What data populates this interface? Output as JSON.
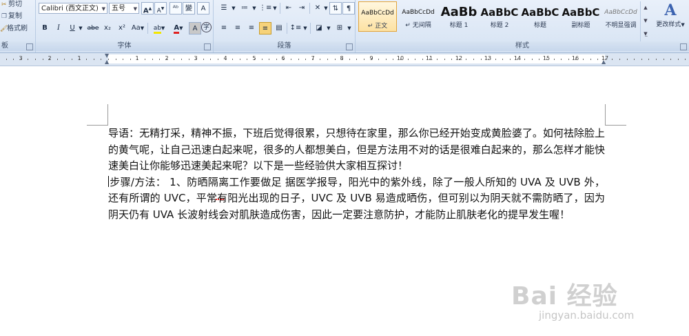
{
  "clipboard": {
    "cut_label": "剪切",
    "copy_label": "复制",
    "format_painter_label": "格式刷",
    "group_label": "板"
  },
  "font": {
    "group_label": "字体",
    "font_name": "Calibri (西文正文)",
    "font_size": "五号",
    "grow_label": "A",
    "shrink_label": "A",
    "clear_format_label": "ᴬᵇ",
    "phonetic_label": "變",
    "border_char_label": "A",
    "bold_label": "B",
    "italic_label": "I",
    "underline_label": "U",
    "strike_label": "abe",
    "subscript_label": "x₂",
    "superscript_label": "x²",
    "case_label": "Aa",
    "highlight_label": "ab",
    "font_color_label": "A",
    "char_shading_label": "A",
    "enclose_label": "字",
    "font_color_hex": "#e02020",
    "highlight_hex": "#f3e600"
  },
  "paragraph": {
    "group_label": "段落"
  },
  "styles": {
    "group_label": "样式",
    "items": [
      {
        "preview": "AaBbCcDd",
        "name": "↵ 正文",
        "selected": true
      },
      {
        "preview": "AaBbCcDd",
        "name": "↵ 无间隔",
        "selected": false
      },
      {
        "preview": "AaBb",
        "name": "标题 1",
        "selected": false
      },
      {
        "preview": "AaBbC",
        "name": "标题 2",
        "selected": false
      },
      {
        "preview": "AaBbC",
        "name": "标题",
        "selected": false
      },
      {
        "preview": "AaBbC",
        "name": "副标题",
        "selected": false
      },
      {
        "preview": "AaBbCcDd",
        "name": "不明显强调",
        "selected": false
      }
    ],
    "change_styles_label": "更改样式"
  },
  "ruler": {
    "left_numbers": [
      "3",
      "2",
      "1"
    ],
    "right_numbers": [
      "1",
      "2",
      "3",
      "4",
      "5",
      "6",
      "7",
      "8",
      "9",
      "10",
      "11",
      "12",
      "13",
      "14",
      "15",
      "16",
      "17"
    ]
  },
  "document": {
    "paragraphs": [
      "导语：无精打采，精神不振，下班后觉得很累，只想待在家里，那么你已经开始变成黄脸婆了。如何祛除脸上的黄气呢，让自己迅速白起来呢，很多的人都想美白，但是方法用不对的话是很难白起来的，那么怎样才能快速美白让你能够迅速美起来呢？以下是一些经验供大家相互探讨！",
      "步骤/方法：    1、防晒隔离工作要做足    据医学报导，阳光中的紫外线，除了一般人所知的 UVA 及 UVB 外，还有所谓的 UVC，平常有阳光出现的日子，UVC 及 UVB 易造成晒伤，但可别以为阴天就不需防晒了，因为阴天仍有 UVA 长波射线会对肌肤造成伤害，因此一定要注意防护，才能防止肌肤老化的提早发生喔！"
    ]
  },
  "watermark": {
    "brand": "Bai 经验",
    "url": "jingyan.baidu.com"
  }
}
